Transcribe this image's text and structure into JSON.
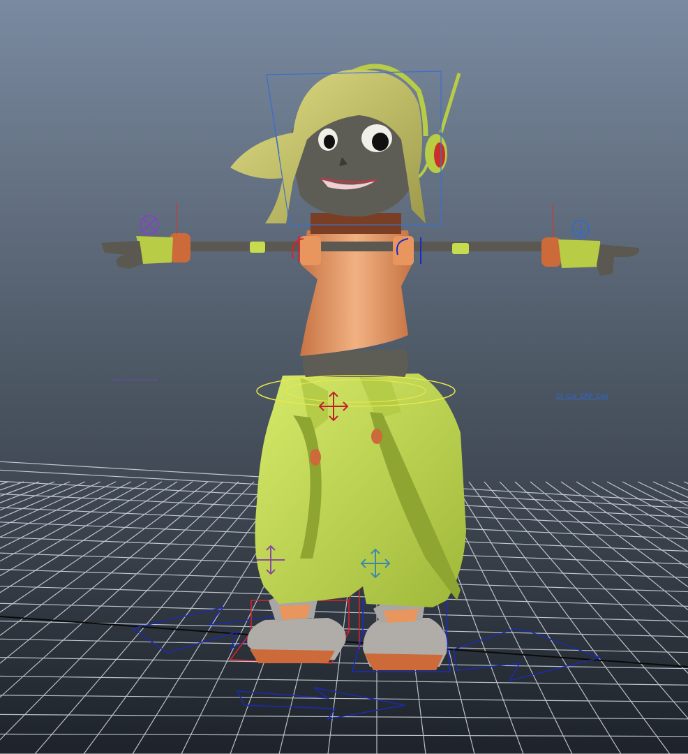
{
  "viewport": {
    "background_top": "#7a8aa0",
    "background_bottom": "#1e232a",
    "grid_color": "#d8dde3",
    "axis_line_color": "#0a0a0a"
  },
  "character": {
    "hair_color": "#c8c46a",
    "skin_color": "#5e5d55",
    "shirt_color": "#e8965e",
    "pants_color": "#c6dc4e",
    "accent_color": "#cc6a3a",
    "headset_color": "#b8cc46",
    "arm_color": "#5a5850"
  },
  "controls": {
    "head_box_color": "#3f6fc8",
    "hip_ring_color": "#e8e84a",
    "left_foot_color": "#e0202a",
    "right_foot_color": "#1a2ac8",
    "left_label_color": "#8a3ad8",
    "right_label_color": "#2a6ad8",
    "move_icon_names": [
      "move-arrows-icon",
      "rotate-icon"
    ]
  },
  "labels": {
    "left_control_label": "~~~~~~~~~",
    "right_control_label": "Ct_Cur_CRP_Cpn"
  }
}
